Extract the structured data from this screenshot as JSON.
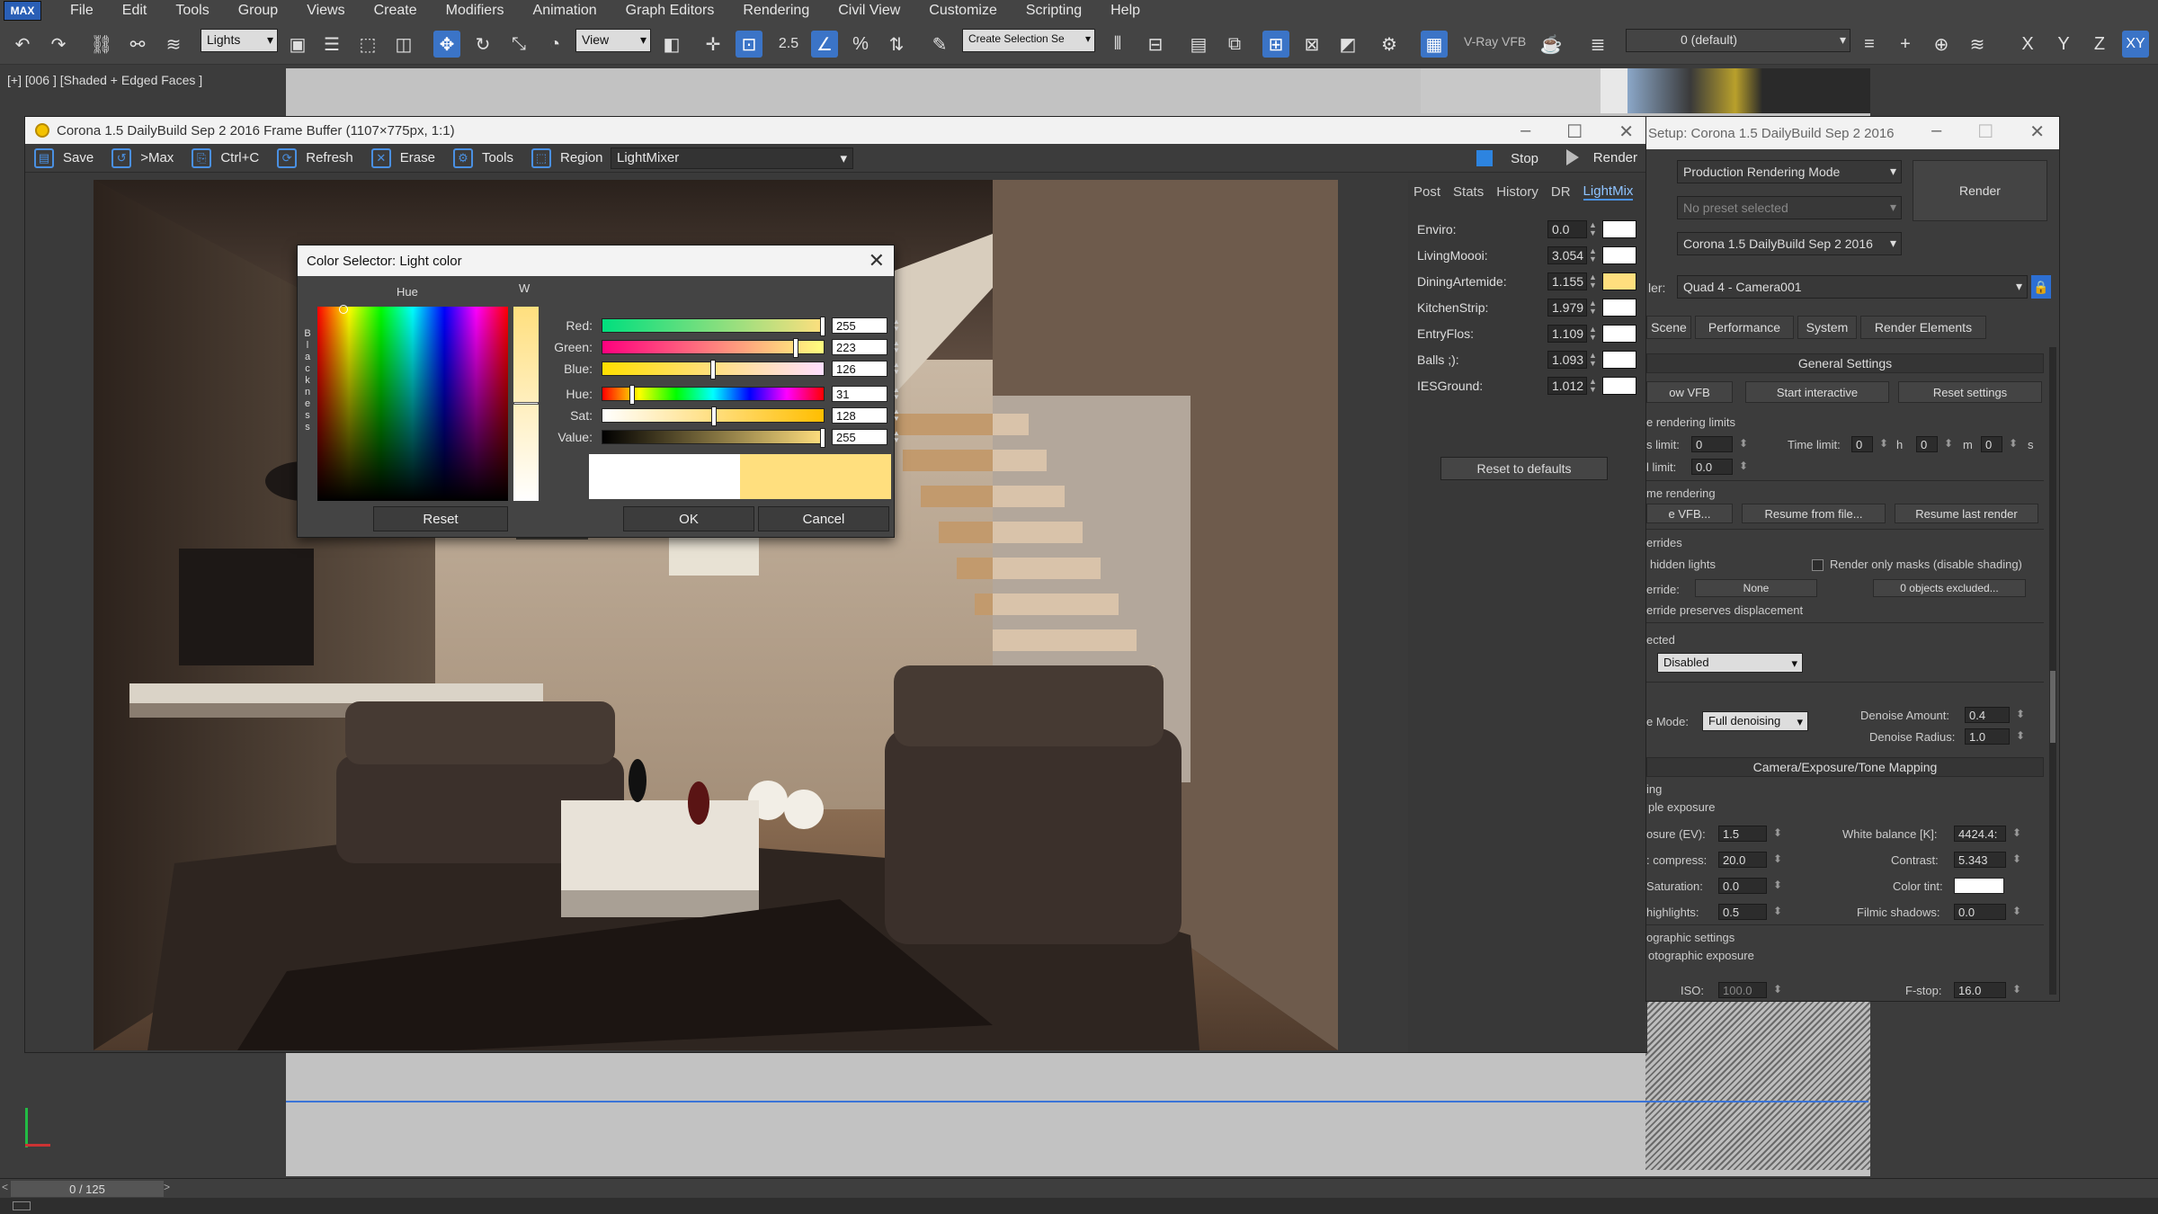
{
  "app": {
    "logo": "MAX"
  },
  "menu": [
    "File",
    "Edit",
    "Tools",
    "Group",
    "Views",
    "Create",
    "Modifiers",
    "Animation",
    "Graph Editors",
    "Rendering",
    "Civil View",
    "Customize",
    "Scripting",
    "Help"
  ],
  "toolbar": {
    "selection_filter": "Lights",
    "ref_coord": "View",
    "named_sel": "Create Selection Se",
    "snap_value": "2.5",
    "renderer_label": "V-Ray VFB",
    "layer": "0 (default)",
    "axis_labels": [
      "X",
      "Y",
      "Z",
      "XY"
    ]
  },
  "viewport": {
    "label": "[+] [006 ] [Shaded + Edged Faces ]"
  },
  "frame_buffer": {
    "title": "Corona 1.5 DailyBuild Sep  2 2016 Frame Buffer (1107×775px, 1:1)",
    "buttons": [
      "Save",
      ">Max",
      "Ctrl+C",
      "Refresh",
      "Erase",
      "Tools",
      "Region"
    ],
    "lightmix_select": "LightMixer",
    "stop": "Stop",
    "render": "Render",
    "tabs": [
      "Post",
      "Stats",
      "History",
      "DR",
      "LightMix"
    ],
    "active_tab": "LightMix",
    "lights": [
      {
        "name": "Enviro:",
        "value": "0.0",
        "color": "#ffffff"
      },
      {
        "name": "LivingMoooi:",
        "value": "3.054",
        "color": "#ffffff"
      },
      {
        "name": "DiningArtemide:",
        "value": "1.155",
        "color": "#ffdf7e"
      },
      {
        "name": "KitchenStrip:",
        "value": "1.979",
        "color": "#ffffff"
      },
      {
        "name": "EntryFlos:",
        "value": "1.109",
        "color": "#ffffff"
      },
      {
        "name": "Balls ;):",
        "value": "1.093",
        "color": "#ffffff"
      },
      {
        "name": "IESGround:",
        "value": "1.012",
        "color": "#ffffff"
      }
    ],
    "reset": "Reset to defaults"
  },
  "color_selector": {
    "title": "Color Selector: Light color",
    "hue_label": "Hue",
    "white_label": "W",
    "blackness_label": "Blackness",
    "rows": [
      {
        "label": "Red:",
        "value": "255",
        "level": 1.0
      },
      {
        "label": "Green:",
        "value": "223",
        "level": 0.875
      },
      {
        "label": "Blue:",
        "value": "126",
        "level": 0.494
      },
      {
        "label": "Hue:",
        "value": "31",
        "level": 0.122
      },
      {
        "label": "Sat:",
        "value": "128",
        "level": 0.502
      },
      {
        "label": "Value:",
        "value": "255",
        "level": 1.0
      }
    ],
    "reset": "Reset",
    "ok": "OK",
    "cancel": "Cancel",
    "old_color": "#ffffff",
    "new_color": "#ffdf7e"
  },
  "render_setup": {
    "title": "Setup: Corona 1.5 DailyBuild Sep  2 2016",
    "mode": "Production Rendering Mode",
    "preset": "No preset selected",
    "renderer": "Corona 1.5 DailyBuild Sep  2 2016",
    "render_btn": "Render",
    "view_prefix": "ler:",
    "view": "Quad 4 - Camera001",
    "tabs": [
      "Scene",
      "Performance",
      "System",
      "Render Elements"
    ],
    "general": "General Settings",
    "show_vfb": "ow VFB",
    "start_interactive": "Start interactive",
    "reset_settings": "Reset settings",
    "limits_label": "e rendering limits",
    "s_limit": "s limit:",
    "s_limit_val": "0",
    "time_limit": "Time limit:",
    "time_h": "0",
    "h": "h",
    "time_m": "0",
    "m": "m",
    "time_s": "0",
    "s": "s",
    "l_limit": "l limit:",
    "l_limit_val": "0.0",
    "resume_label": "me rendering",
    "e_vfb": "e VFB...",
    "resume_file": "Resume from file...",
    "resume_last": "Resume last render",
    "overrides": "errides",
    "hidden_lights": "hidden lights",
    "render_masks": "Render only masks (disable shading)",
    "erride": "erride:",
    "none": "None",
    "excluded": "0 objects excluded...",
    "preserve": "erride preserves displacement",
    "ected": "ected",
    "disabled": "Disabled",
    "e_mode": "e Mode:",
    "full_denoise": "Full denoising",
    "denoise_amount": "Denoise Amount:",
    "denoise_amount_val": "0.4",
    "denoise_radius": "Denoise Radius:",
    "denoise_radius_val": "1.0",
    "camera_header": "Camera/Exposure/Tone Mapping",
    "ing": "ing",
    "simple_exposure": "ple exposure",
    "exposure_ev": "osure (EV):",
    "exposure_ev_val": "1.5",
    "white_balance": "White balance [K]:",
    "white_balance_val": "4424.4:",
    "compress": ": compress:",
    "compress_val": "20.0",
    "contrast": "Contrast:",
    "contrast_val": "5.343",
    "saturation": "Saturation:",
    "saturation_val": "0.0",
    "color_tint": "Color tint:",
    "highlights": "highlights:",
    "highlights_val": "0.5",
    "filmic_shadows": "Filmic shadows:",
    "filmic_shadows_val": "0.0",
    "photo_settings": "ographic settings",
    "photo_exposure": "otographic exposure",
    "iso": "ISO:",
    "iso_val": "100.0",
    "fstop": "F-stop:",
    "fstop_val": "16.0"
  },
  "timeline": {
    "frame": "0 / 125"
  }
}
